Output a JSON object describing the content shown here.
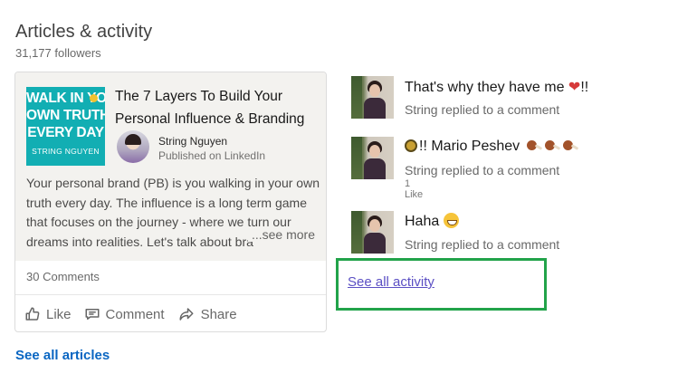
{
  "section": {
    "title": "Articles & activity",
    "followers": "31,177 followers"
  },
  "article": {
    "thumbnail_lines": [
      "WALK IN YOUR",
      "OWN TRUTH",
      "EVERY DAY"
    ],
    "thumbnail_author": "STRING NGUYEN",
    "thumbnail_color": "#12aeb3",
    "title": "The 7 Layers To Build Your Personal Influence & Branding",
    "author_name": "String Nguyen",
    "published": "Published on LinkedIn",
    "excerpt": "Your personal brand (PB) is you walking in your own truth every day. The influence is a long term game that focuses on the journey - where we turn our dreams into realities. Let's talk about bra",
    "see_more": "...see more",
    "comments": "30 Comments",
    "actions": {
      "like": "Like",
      "comment": "Comment",
      "share": "Share"
    }
  },
  "see_all_articles": "See all articles",
  "activity": [
    {
      "title": "That's why they have me",
      "emoji": "heart",
      "suffix": "!!",
      "subtitle": "String replied to a comment",
      "likes": ""
    },
    {
      "prefix": "!!",
      "title": "Mario Peshev",
      "emoji": "drumsticks",
      "subtitle": "String replied to a comment",
      "likes": "1 Like"
    },
    {
      "title": "Haha",
      "emoji": "grin",
      "subtitle": "String replied to a comment",
      "likes": ""
    }
  ],
  "see_all_activity": "See all activity",
  "colors": {
    "link_blue": "#0a66c2",
    "activity_link": "#5b4fc4",
    "highlight_green": "#22a34a"
  }
}
